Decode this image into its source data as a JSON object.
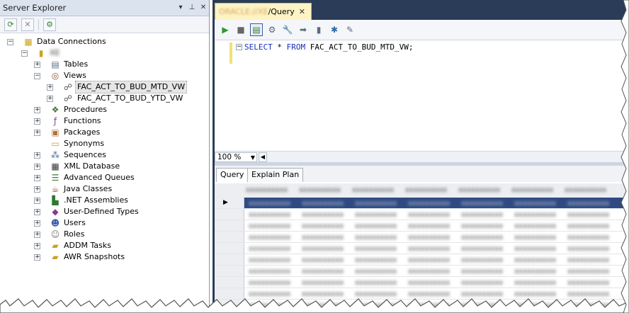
{
  "server_explorer": {
    "title": "Server Explorer",
    "title_buttons": [
      "▾",
      "⊥",
      "✕"
    ],
    "toolbar": [
      "refresh-icon",
      "stop-icon",
      "connect-server-icon"
    ],
    "tree": [
      {
        "level": 0,
        "expander": "−",
        "icon": "data-connections-icon",
        "label": "Data Connections"
      },
      {
        "level": 1,
        "expander": "−",
        "icon": "database-icon",
        "label": "XE"
      },
      {
        "level": 2,
        "expander": "+",
        "icon": "tables-icon",
        "label": "Tables"
      },
      {
        "level": 2,
        "expander": "−",
        "icon": "views-icon",
        "label": "Views"
      },
      {
        "level": 3,
        "expander": "+",
        "icon": "view-icon",
        "label": "FAC_ACT_TO_BUD_MTD_VW",
        "selected": true
      },
      {
        "level": 3,
        "expander": "+",
        "icon": "view-icon",
        "label": "FAC_ACT_TO_BUD_YTD_VW"
      },
      {
        "level": 2,
        "expander": "+",
        "icon": "procedures-icon",
        "label": "Procedures"
      },
      {
        "level": 2,
        "expander": "+",
        "icon": "functions-icon",
        "label": "Functions"
      },
      {
        "level": 2,
        "expander": "+",
        "icon": "packages-icon",
        "label": "Packages"
      },
      {
        "level": 2,
        "expander": "",
        "icon": "synonyms-icon",
        "label": "Synonyms"
      },
      {
        "level": 2,
        "expander": "+",
        "icon": "sequences-icon",
        "label": "Sequences"
      },
      {
        "level": 2,
        "expander": "+",
        "icon": "xml-database-icon",
        "label": "XML Database"
      },
      {
        "level": 2,
        "expander": "+",
        "icon": "advanced-queues-icon",
        "label": "Advanced Queues"
      },
      {
        "level": 2,
        "expander": "+",
        "icon": "java-classes-icon",
        "label": "Java Classes"
      },
      {
        "level": 2,
        "expander": "+",
        "icon": "net-assemblies-icon",
        "label": ".NET Assemblies"
      },
      {
        "level": 2,
        "expander": "+",
        "icon": "user-defined-types-icon",
        "label": "User-Defined Types"
      },
      {
        "level": 2,
        "expander": "+",
        "icon": "users-icon",
        "label": "Users"
      },
      {
        "level": 2,
        "expander": "+",
        "icon": "roles-icon",
        "label": "Roles"
      },
      {
        "level": 2,
        "expander": "+",
        "icon": "addm-tasks-icon",
        "label": "ADDM Tasks"
      },
      {
        "level": 2,
        "expander": "+",
        "icon": "awr-snapshots-icon",
        "label": "AWR Snapshots"
      }
    ]
  },
  "document_tab": {
    "prefix": "ORACLE://XE",
    "label": "/Query",
    "close": "✕"
  },
  "query_toolbar": [
    "run-icon",
    "stop-icon",
    "results-to-grid-icon",
    "query-builder-icon",
    "wrench-icon",
    "execute-icon",
    "sql-icon",
    "plan-icon",
    "grid-icon",
    "edit-icon"
  ],
  "editor": {
    "code_keyword1": "SELECT",
    "code_mid": " * ",
    "code_keyword2": "FROM",
    "code_rest": " FAC_ACT_TO_BUD_MTD_VW;",
    "fold": "−"
  },
  "zoom": {
    "value": "100 %"
  },
  "result_tabs": [
    "Query",
    "Explain Plan"
  ],
  "grid": {
    "columns": [
      "xxxxxxxxxx",
      "xxxxxxxxxx",
      "xxxxxxxxxx",
      "xxxxxxxxxx",
      "xxxxxxxxxx",
      "xxxxxxxxxx",
      "xxxxxxxxxx"
    ],
    "row_pointer": "▶",
    "rows": 11,
    "colors": {
      "selected_row": "#2f4a82"
    }
  },
  "colors": {
    "doc_background": "#2b3c59",
    "tab_active": "#fdf3c4",
    "keyword": "#1a2fb5"
  }
}
